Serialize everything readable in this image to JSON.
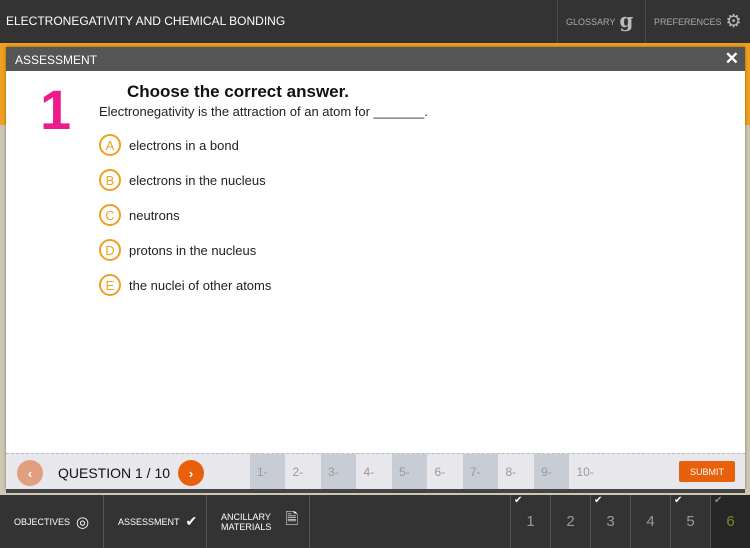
{
  "header": {
    "title": "ELECTRONEGATIVITY AND CHEMICAL BONDING",
    "glossary": "GLOSSARY",
    "preferences": "PREFERENCES"
  },
  "modal": {
    "title": "ASSESSMENT",
    "close": "✕",
    "number": "1",
    "heading": "Choose the correct answer.",
    "question": "Electronegativity is the attraction of an atom for _______.",
    "options": [
      {
        "letter": "A",
        "text": "electrons in a bond"
      },
      {
        "letter": "B",
        "text": "electrons in the nucleus"
      },
      {
        "letter": "C",
        "text": "neutrons"
      },
      {
        "letter": "D",
        "text": "protons in the nucleus"
      },
      {
        "letter": "E",
        "text": "the nuclei of other atoms"
      }
    ],
    "footer": {
      "question_label": "QUESTION 1 / 10",
      "questions": [
        "1-",
        "2-",
        "3-",
        "4-",
        "5-",
        "6-",
        "7-",
        "8-",
        "9-",
        "10-"
      ],
      "submit": "SUBMIT"
    }
  },
  "bottom": {
    "objectives": "OBJECTIVES",
    "assessment": "ASSESSMENT",
    "ancillary1": "ANCILLARY",
    "ancillary2": "MATERIALS",
    "pages": [
      {
        "n": "1",
        "done": true
      },
      {
        "n": "2",
        "done": false
      },
      {
        "n": "3",
        "done": true
      },
      {
        "n": "4",
        "done": false
      },
      {
        "n": "5",
        "done": true
      },
      {
        "n": "6",
        "done": true
      }
    ]
  },
  "colors": {
    "accent": "#f0a020",
    "number": "#ee1a8c",
    "submit": "#e8600c",
    "current_page": "#7a8a2a"
  }
}
